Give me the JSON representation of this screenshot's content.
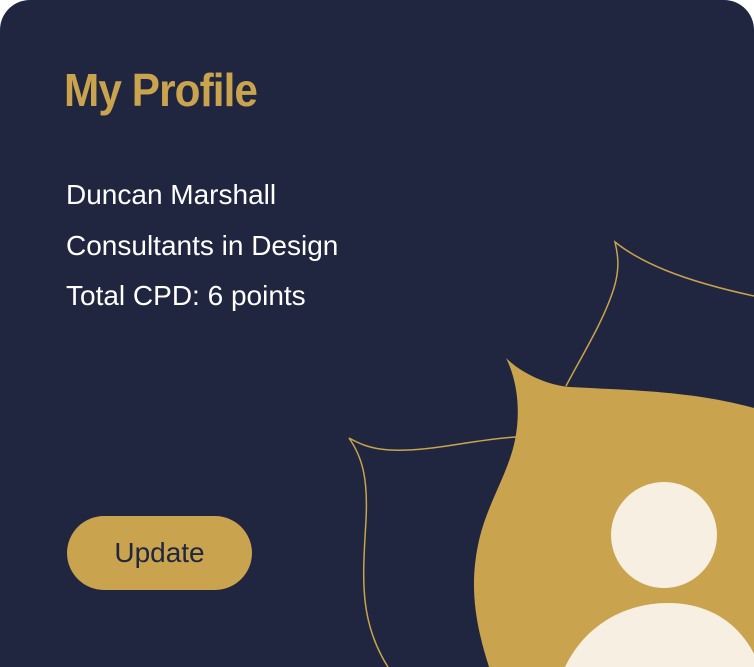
{
  "profile": {
    "title": "My Profile",
    "name": "Duncan Marshall",
    "company": "Consultants in Design",
    "cpd": "Total CPD: 6 points",
    "update_label": "Update"
  },
  "icons": {
    "avatar": "user-avatar-icon",
    "decoration": "leaf-decoration-icon"
  },
  "colors": {
    "background": "#20263f",
    "accent": "#c9a34d",
    "text": "#ffffff",
    "avatar": "#f7efe1",
    "button_text": "#20263f"
  }
}
